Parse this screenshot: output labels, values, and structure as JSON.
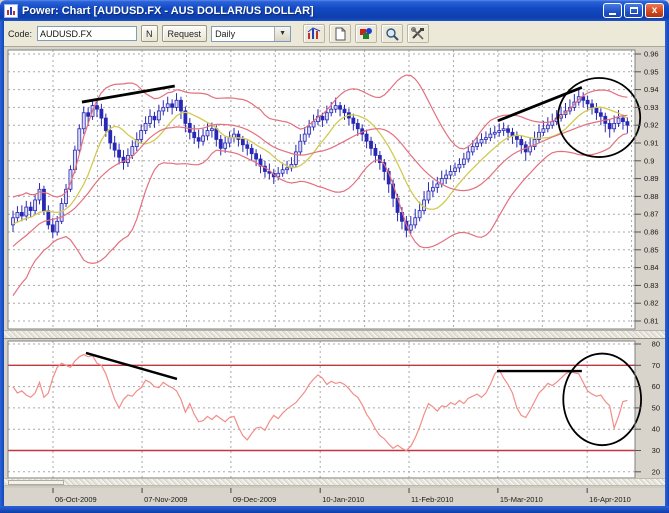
{
  "window": {
    "title": "Power: Chart [AUDUSD.FX - AUS DOLLAR/US DOLLAR]",
    "controls": [
      "minimize-icon",
      "maximize-icon",
      "close-icon"
    ],
    "close_glyph": "x"
  },
  "toolbar": {
    "code_label": "Code:",
    "code_value": "AUDUSD.FX",
    "n_button": "N",
    "request_button": "Request",
    "period_value": "Daily",
    "dropdown_arrow": "▼",
    "icons": [
      "chart-icon",
      "new-document-icon",
      "image-icon",
      "zoom-icon",
      "tools-icon"
    ]
  },
  "colors": {
    "titlebar_blue": "#1349c2",
    "client_gray": "#d8d4cb",
    "plot_bg": "#ffffff",
    "plot_border": "#7f7f7f",
    "grid": "#a8a8a8",
    "candle_stroke": "#2828b4",
    "candle_up_fill": "#dcdcf4",
    "candle_down_fill": "#2828b4",
    "bollinger": "#e4707e",
    "ma_yellow": "#d2ca52",
    "rsi_line": "#f28d88",
    "rsi_threshold": "#c2363f",
    "annotation": "#000000",
    "axis_text": "#1a1a1a"
  },
  "chart_data": {
    "type": "candlestick",
    "title": "AUDUSD.FX - AUS DOLLAR/US DOLLAR",
    "grid": {
      "main_vertical": "ticks-and-midpoints",
      "rsi_vertical": "ticks-only",
      "horizontal": "all-price-ticks"
    },
    "price_axis": {
      "side": "right",
      "ticks": [
        {
          "label": "0.96",
          "value": 0.96
        },
        {
          "label": "0.95",
          "value": 0.95
        },
        {
          "label": "0.94",
          "value": 0.94
        },
        {
          "label": "0.93",
          "value": 0.93
        },
        {
          "label": "0.92",
          "value": 0.92
        },
        {
          "label": "0.91",
          "value": 0.91
        },
        {
          "label": "0.9",
          "value": 0.9
        },
        {
          "label": "0.89",
          "value": 0.89
        },
        {
          "label": "0.88",
          "value": 0.88
        },
        {
          "label": "0.87",
          "value": 0.87
        },
        {
          "label": "0.86",
          "value": 0.86
        },
        {
          "label": "0.85",
          "value": 0.85
        },
        {
          "label": "0.84",
          "value": 0.84
        },
        {
          "label": "0.83",
          "value": 0.83
        },
        {
          "label": "0.82",
          "value": 0.82
        },
        {
          "label": "0.81",
          "value": 0.81
        }
      ]
    },
    "rsi_axis": {
      "side": "right",
      "ticks": [
        {
          "label": "80",
          "value": 80
        },
        {
          "label": "70",
          "value": 70
        },
        {
          "label": "60",
          "value": 60
        },
        {
          "label": "50",
          "value": 50
        },
        {
          "label": "40",
          "value": 40
        },
        {
          "label": "30",
          "value": 30
        },
        {
          "label": "20",
          "value": 20
        }
      ],
      "overbought": 70,
      "oversold": 30
    },
    "date_axis": [
      {
        "label": "06-Oct-2009",
        "index": 9.05
      },
      {
        "label": "07-Nov-2009",
        "index": 29.2
      },
      {
        "label": "09-Dec-2009",
        "index": 49.3
      },
      {
        "label": "10-Jan-2010",
        "index": 69.5
      },
      {
        "label": "11-Feb-2010",
        "index": 89.6
      },
      {
        "label": "15-Mar-2010",
        "index": 109.7
      },
      {
        "label": "16-Apr-2010",
        "index": 129.9
      }
    ],
    "overlays": {
      "bollinger": {
        "period": 20,
        "mult": 1.9
      },
      "ma": {
        "period": 10
      }
    },
    "warmup_closes": [
      0.822,
      0.826,
      0.83,
      0.835,
      0.828,
      0.834,
      0.84,
      0.846,
      0.852,
      0.848,
      0.855,
      0.86,
      0.857,
      0.863,
      0.868,
      0.864,
      0.87,
      0.866,
      0.862,
      0.866
    ],
    "candles": [
      [
        0.864,
        0.872,
        0.86,
        0.868
      ],
      [
        0.868,
        0.8745,
        0.8655,
        0.871
      ],
      [
        0.871,
        0.875,
        0.866,
        0.869
      ],
      [
        0.869,
        0.8775,
        0.8665,
        0.874
      ],
      [
        0.874,
        0.877,
        0.8685,
        0.872
      ],
      [
        0.872,
        0.8815,
        0.87,
        0.878
      ],
      [
        0.878,
        0.8875,
        0.8755,
        0.884
      ],
      [
        0.884,
        0.886,
        0.8695,
        0.872
      ],
      [
        0.872,
        0.875,
        0.8615,
        0.864
      ],
      [
        0.864,
        0.868,
        0.8565,
        0.86
      ],
      [
        0.86,
        0.869,
        0.858,
        0.866
      ],
      [
        0.866,
        0.879,
        0.8645,
        0.876
      ],
      [
        0.876,
        0.887,
        0.874,
        0.884
      ],
      [
        0.884,
        0.8975,
        0.8825,
        0.895
      ],
      [
        0.895,
        0.9085,
        0.893,
        0.906
      ],
      [
        0.906,
        0.9205,
        0.904,
        0.918
      ],
      [
        0.918,
        0.9305,
        0.915,
        0.927
      ],
      [
        0.927,
        0.93,
        0.9195,
        0.925
      ],
      [
        0.925,
        0.934,
        0.923,
        0.931
      ],
      [
        0.931,
        0.9345,
        0.9245,
        0.929
      ],
      [
        0.929,
        0.932,
        0.9195,
        0.924
      ],
      [
        0.924,
        0.9265,
        0.9135,
        0.917
      ],
      [
        0.917,
        0.92,
        0.9065,
        0.91
      ],
      [
        0.91,
        0.914,
        0.902,
        0.906
      ],
      [
        0.906,
        0.9095,
        0.898,
        0.902
      ],
      [
        0.902,
        0.906,
        0.895,
        0.899
      ],
      [
        0.899,
        0.907,
        0.8965,
        0.903
      ],
      [
        0.903,
        0.9115,
        0.901,
        0.908
      ],
      [
        0.908,
        0.916,
        0.9055,
        0.912
      ],
      [
        0.912,
        0.9205,
        0.91,
        0.917
      ],
      [
        0.917,
        0.925,
        0.915,
        0.921
      ],
      [
        0.921,
        0.929,
        0.9185,
        0.925
      ],
      [
        0.925,
        0.9275,
        0.9185,
        0.923
      ],
      [
        0.923,
        0.9315,
        0.921,
        0.928
      ],
      [
        0.928,
        0.934,
        0.9255,
        0.93
      ],
      [
        0.93,
        0.936,
        0.9275,
        0.932
      ],
      [
        0.932,
        0.9345,
        0.926,
        0.93
      ],
      [
        0.93,
        0.938,
        0.928,
        0.934
      ],
      [
        0.934,
        0.936,
        0.9235,
        0.928
      ],
      [
        0.928,
        0.9305,
        0.916,
        0.921
      ],
      [
        0.921,
        0.924,
        0.912,
        0.916
      ],
      [
        0.916,
        0.92,
        0.9095,
        0.913
      ],
      [
        0.913,
        0.9175,
        0.907,
        0.911
      ],
      [
        0.911,
        0.918,
        0.9085,
        0.914
      ],
      [
        0.914,
        0.921,
        0.9115,
        0.917
      ],
      [
        0.917,
        0.9215,
        0.913,
        0.918
      ],
      [
        0.918,
        0.92,
        0.908,
        0.912
      ],
      [
        0.912,
        0.9145,
        0.903,
        0.907
      ],
      [
        0.907,
        0.914,
        0.9045,
        0.91
      ],
      [
        0.91,
        0.9165,
        0.9075,
        0.913
      ],
      [
        0.913,
        0.9185,
        0.9105,
        0.915
      ],
      [
        0.915,
        0.917,
        0.908,
        0.912
      ],
      [
        0.912,
        0.914,
        0.905,
        0.909
      ],
      [
        0.909,
        0.9115,
        0.903,
        0.907
      ],
      [
        0.907,
        0.9095,
        0.9,
        0.904
      ],
      [
        0.904,
        0.9065,
        0.897,
        0.901
      ],
      [
        0.901,
        0.9035,
        0.893,
        0.897
      ],
      [
        0.897,
        0.9,
        0.8905,
        0.894
      ],
      [
        0.894,
        0.8985,
        0.8895,
        0.893
      ],
      [
        0.893,
        0.8955,
        0.887,
        0.891
      ],
      [
        0.891,
        0.8965,
        0.889,
        0.893
      ],
      [
        0.893,
        0.899,
        0.891,
        0.895
      ],
      [
        0.895,
        0.9,
        0.8925,
        0.896
      ],
      [
        0.896,
        0.902,
        0.894,
        0.898
      ],
      [
        0.898,
        0.909,
        0.8965,
        0.905
      ],
      [
        0.905,
        0.915,
        0.903,
        0.911
      ],
      [
        0.911,
        0.919,
        0.909,
        0.915
      ],
      [
        0.915,
        0.923,
        0.913,
        0.919
      ],
      [
        0.919,
        0.926,
        0.917,
        0.922
      ],
      [
        0.922,
        0.929,
        0.92,
        0.925
      ],
      [
        0.925,
        0.927,
        0.919,
        0.923
      ],
      [
        0.923,
        0.931,
        0.921,
        0.927
      ],
      [
        0.927,
        0.933,
        0.925,
        0.929
      ],
      [
        0.929,
        0.9355,
        0.927,
        0.931
      ],
      [
        0.931,
        0.933,
        0.925,
        0.929
      ],
      [
        0.929,
        0.9315,
        0.923,
        0.927
      ],
      [
        0.927,
        0.9295,
        0.92,
        0.924
      ],
      [
        0.924,
        0.9265,
        0.917,
        0.921
      ],
      [
        0.921,
        0.9235,
        0.914,
        0.918
      ],
      [
        0.918,
        0.9205,
        0.911,
        0.915
      ],
      [
        0.915,
        0.9175,
        0.907,
        0.911
      ],
      [
        0.911,
        0.9135,
        0.903,
        0.907
      ],
      [
        0.907,
        0.9095,
        0.899,
        0.903
      ],
      [
        0.903,
        0.9055,
        0.895,
        0.899
      ],
      [
        0.899,
        0.901,
        0.889,
        0.894
      ],
      [
        0.894,
        0.896,
        0.882,
        0.887
      ],
      [
        0.887,
        0.8895,
        0.874,
        0.879
      ],
      [
        0.879,
        0.8815,
        0.866,
        0.871
      ],
      [
        0.871,
        0.874,
        0.8615,
        0.866
      ],
      [
        0.866,
        0.869,
        0.857,
        0.861
      ],
      [
        0.861,
        0.869,
        0.859,
        0.864
      ],
      [
        0.864,
        0.873,
        0.862,
        0.868
      ],
      [
        0.868,
        0.877,
        0.866,
        0.872
      ],
      [
        0.872,
        0.883,
        0.87,
        0.878
      ],
      [
        0.878,
        0.888,
        0.876,
        0.883
      ],
      [
        0.883,
        0.889,
        0.8795,
        0.885
      ],
      [
        0.885,
        0.891,
        0.882,
        0.887
      ],
      [
        0.887,
        0.8945,
        0.885,
        0.89
      ],
      [
        0.89,
        0.895,
        0.887,
        0.892
      ],
      [
        0.892,
        0.8975,
        0.8895,
        0.894
      ],
      [
        0.894,
        0.899,
        0.8915,
        0.896
      ],
      [
        0.896,
        0.9015,
        0.8935,
        0.898
      ],
      [
        0.898,
        0.9045,
        0.896,
        0.901
      ],
      [
        0.901,
        0.9085,
        0.899,
        0.905
      ],
      [
        0.905,
        0.9115,
        0.903,
        0.908
      ],
      [
        0.908,
        0.9135,
        0.906,
        0.91
      ],
      [
        0.91,
        0.9155,
        0.908,
        0.912
      ],
      [
        0.912,
        0.9165,
        0.9095,
        0.913
      ],
      [
        0.913,
        0.9185,
        0.911,
        0.915
      ],
      [
        0.915,
        0.9195,
        0.9125,
        0.916
      ],
      [
        0.916,
        0.921,
        0.9135,
        0.917
      ],
      [
        0.917,
        0.9215,
        0.914,
        0.918
      ],
      [
        0.918,
        0.92,
        0.9115,
        0.916
      ],
      [
        0.916,
        0.9185,
        0.9095,
        0.914
      ],
      [
        0.914,
        0.9165,
        0.9075,
        0.912
      ],
      [
        0.912,
        0.914,
        0.904,
        0.909
      ],
      [
        0.909,
        0.911,
        0.9,
        0.905
      ],
      [
        0.905,
        0.913,
        0.903,
        0.908
      ],
      [
        0.908,
        0.9165,
        0.906,
        0.912
      ],
      [
        0.912,
        0.9205,
        0.91,
        0.916
      ],
      [
        0.916,
        0.9225,
        0.914,
        0.918
      ],
      [
        0.918,
        0.9245,
        0.916,
        0.92
      ],
      [
        0.92,
        0.9265,
        0.918,
        0.922
      ],
      [
        0.922,
        0.9285,
        0.92,
        0.924
      ],
      [
        0.924,
        0.9305,
        0.922,
        0.926
      ],
      [
        0.926,
        0.9325,
        0.924,
        0.928
      ],
      [
        0.928,
        0.9345,
        0.926,
        0.93
      ],
      [
        0.93,
        0.9375,
        0.928,
        0.933
      ],
      [
        0.933,
        0.9405,
        0.931,
        0.936
      ],
      [
        0.936,
        0.9385,
        0.93,
        0.934
      ],
      [
        0.934,
        0.9365,
        0.928,
        0.932
      ],
      [
        0.932,
        0.9345,
        0.926,
        0.93
      ],
      [
        0.93,
        0.9325,
        0.923,
        0.927
      ],
      [
        0.927,
        0.9295,
        0.92,
        0.925
      ],
      [
        0.925,
        0.927,
        0.916,
        0.921
      ],
      [
        0.921,
        0.9235,
        0.913,
        0.918
      ],
      [
        0.918,
        0.9255,
        0.916,
        0.921
      ],
      [
        0.921,
        0.9285,
        0.919,
        0.924
      ],
      [
        0.924,
        0.926,
        0.9175,
        0.922
      ],
      [
        0.922,
        0.9245,
        0.9155,
        0.92
      ]
    ],
    "rsi": [
      60,
      57,
      58,
      56,
      55,
      57,
      62,
      55,
      57,
      64,
      69,
      71,
      70,
      69,
      72,
      74,
      75,
      74,
      74.5,
      71,
      70,
      66,
      60,
      54,
      50,
      54,
      56,
      55.5,
      58,
      59.5,
      63,
      62,
      60,
      59.5,
      62,
      60.5,
      59.5,
      58,
      54,
      48,
      52,
      47,
      43.5,
      44,
      46,
      44.5,
      46.5,
      45,
      43.5,
      45.5,
      46,
      41,
      37,
      35,
      38,
      40.5,
      41,
      39.5,
      43.5,
      46.5,
      45,
      47.5,
      49.5,
      51,
      52.5,
      55,
      57.5,
      61,
      63.5,
      65.5,
      64,
      61,
      62.5,
      61.5,
      62,
      61,
      59,
      56.5,
      55,
      51.5,
      47,
      44,
      40,
      37,
      35.5,
      33,
      31,
      32.5,
      31,
      30,
      32,
      36,
      41,
      47,
      52,
      50.5,
      48.5,
      51,
      50.5,
      52.5,
      51.5,
      53.5,
      52,
      54.5,
      55.5,
      56.5,
      55,
      57,
      61,
      66,
      68,
      64,
      61,
      57,
      50,
      46.5,
      45.5,
      49,
      53,
      57,
      59,
      61.5,
      60.5,
      62,
      64,
      66,
      67,
      66.5,
      66,
      62,
      58,
      56.5,
      55.5,
      56,
      53,
      51,
      40.5,
      46,
      53,
      53.5
    ],
    "annotations": {
      "price_trendlines": [
        {
          "i1": 15.6,
          "p1": 0.933,
          "i2": 36.6,
          "p2": 0.942
        },
        {
          "i1": 109.7,
          "p1": 0.9225,
          "i2": 128.7,
          "p2": 0.9412
        }
      ],
      "rsi_trendlines": [
        {
          "i1": 16.5,
          "v1": 75.8,
          "i2": 37.1,
          "v2": 63.6
        },
        {
          "i1": 109.5,
          "v1": 67.3,
          "i2": 128.7,
          "v2": 67.3
        }
      ],
      "price_ellipse": {
        "ci": 132.6,
        "cp": 0.9243,
        "ri": 9.3,
        "rp": 0.0222
      },
      "rsi_ellipse": {
        "ci": 133.3,
        "cv": 54,
        "ri": 8.8,
        "rv": 21.5
      }
    }
  }
}
